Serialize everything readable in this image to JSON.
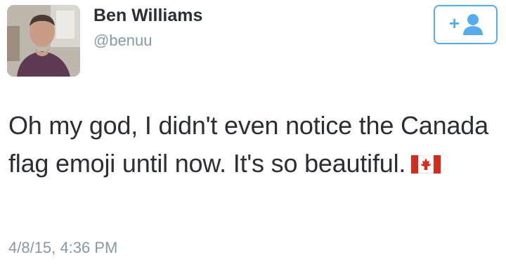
{
  "tweet": {
    "user": {
      "display_name": "Ben Williams",
      "handle": "@benuu",
      "avatar_icon": "profile-photo"
    },
    "follow_button": {
      "icon": "add-user-icon",
      "symbol": "+",
      "color": "#55acee"
    },
    "text": "Oh my god, I didn't even notice the Canada flag emoji until now. It's so beautiful.",
    "emoji": {
      "name": "canada-flag-emoji",
      "red": "#d52b1e",
      "white": "#ffffff"
    },
    "timestamp": "4/8/15, 4:36 PM"
  },
  "colors": {
    "text": "#292f33",
    "secondary": "#8899a6",
    "accent": "#55acee"
  }
}
